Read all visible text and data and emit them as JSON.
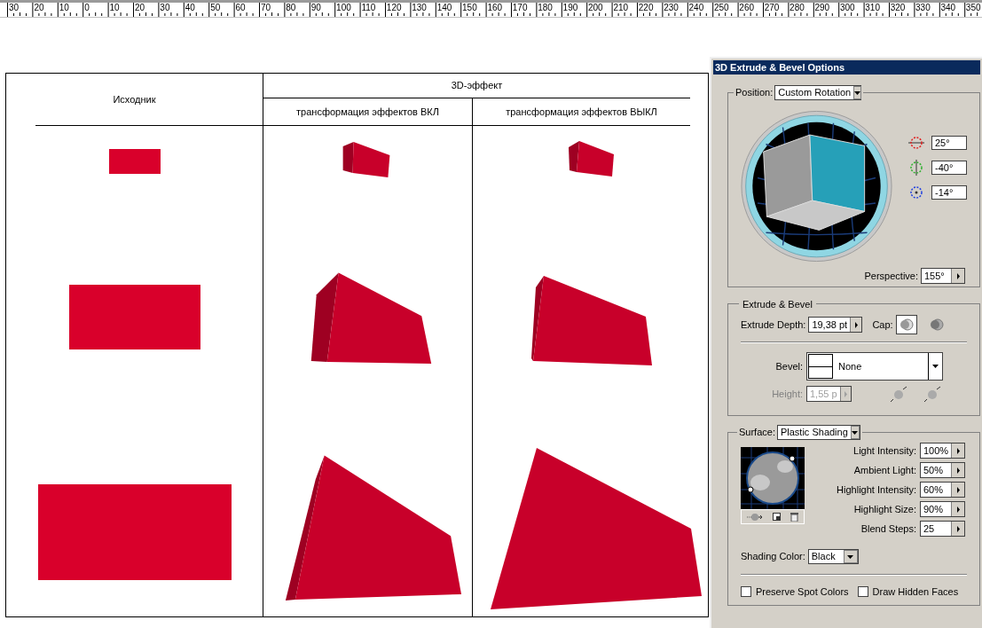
{
  "ruler": {
    "labels": [
      "30",
      "20",
      "10",
      "0",
      "10",
      "20",
      "30",
      "40",
      "50",
      "60",
      "70",
      "80",
      "90",
      "100",
      "110",
      "120",
      "130",
      "140",
      "150",
      "160",
      "170",
      "180",
      "190",
      "200",
      "210",
      "220",
      "230",
      "240",
      "250",
      "260",
      "270",
      "280",
      "290",
      "300",
      "310",
      "320",
      "330",
      "340",
      "350"
    ]
  },
  "table": {
    "source_header": "Исходник",
    "effect_header": "3D-эффект",
    "columns": [
      {
        "label": "трансформация эффектов ВКЛ"
      },
      {
        "label": "трансформация эффектов ВЫКЛ"
      }
    ]
  },
  "dialog": {
    "title": "3D Extrude & Bevel Options",
    "position": {
      "label": "Position:",
      "value": "Custom Rotation",
      "rotations": [
        {
          "kind": "x",
          "value": "25°"
        },
        {
          "kind": "y",
          "value": "-40°"
        },
        {
          "kind": "z",
          "value": "-14°"
        }
      ],
      "perspective_label": "Perspective:",
      "perspective_value": "155°"
    },
    "extrude": {
      "title": "Extrude & Bevel",
      "depth_label": "Extrude Depth:",
      "depth_value": "19,38 pt",
      "cap_label": "Cap:",
      "caps": [
        {
          "selected": true
        },
        {
          "selected": false
        }
      ],
      "bevel_label": "Bevel:",
      "bevel_value": "None",
      "height_label": "Height:",
      "height_value": "1,55 p",
      "height_disabled": true
    },
    "surface": {
      "label": "Surface:",
      "value": "Plastic Shading",
      "fields": [
        {
          "label": "Light Intensity:",
          "value": "100%"
        },
        {
          "label": "Ambient Light:",
          "value": "50%"
        },
        {
          "label": "Highlight Intensity:",
          "value": "60%"
        },
        {
          "label": "Highlight Size:",
          "value": "90%"
        },
        {
          "label": "Blend Steps:",
          "value": "25"
        }
      ],
      "shading_label": "Shading Color:",
      "shading_value": "Black"
    },
    "checkboxes": [
      {
        "label": "Preserve Spot Colors",
        "checked": false
      },
      {
        "label": "Draw Hidden Faces",
        "checked": false
      }
    ]
  }
}
